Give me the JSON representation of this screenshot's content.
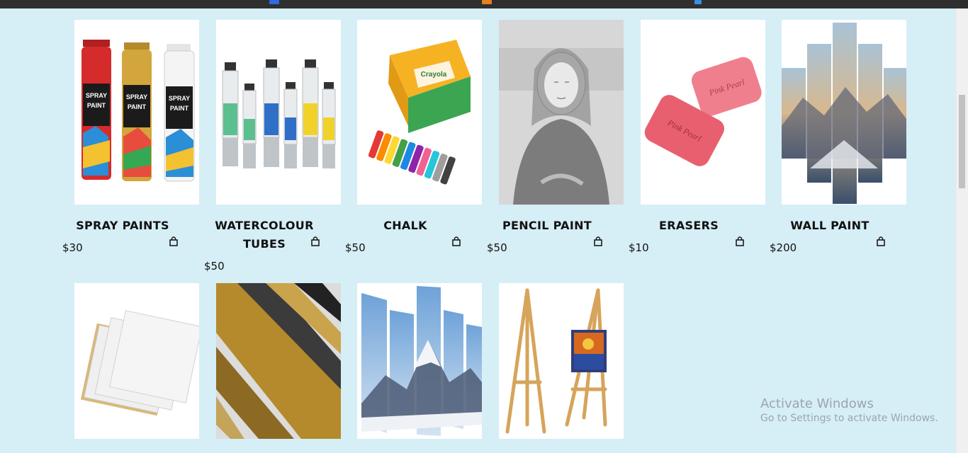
{
  "products": [
    {
      "name": "SPRAY PAINTS",
      "price": "$30",
      "image": "spray-paint-cans"
    },
    {
      "name": "WATERCOLOUR TUBES",
      "price": "$50",
      "image": "watercolour-tubes"
    },
    {
      "name": "CHALK",
      "price": "$50",
      "image": "crayola-drawing-chalk"
    },
    {
      "name": "PENCIL PAINT",
      "price": "$50",
      "image": "pencil-portrait"
    },
    {
      "name": "ERASERS",
      "price": "$10",
      "image": "pink-pearl-erasers"
    },
    {
      "name": "WALL PAINT",
      "price": "$200",
      "image": "mountain-panel-art"
    },
    {
      "image": "blank-canvases"
    },
    {
      "image": "picture-frames"
    },
    {
      "image": "mountain-canvas-panels"
    },
    {
      "image": "wooden-easels"
    }
  ],
  "cart_icon": "shopping-bag-icon",
  "watermark": {
    "line1": "Activate Windows",
    "line2": "Go to Settings to activate Windows."
  },
  "colors": {
    "page_background": "#d6eef6",
    "card_background": "#ffffff",
    "text": "#111111"
  }
}
